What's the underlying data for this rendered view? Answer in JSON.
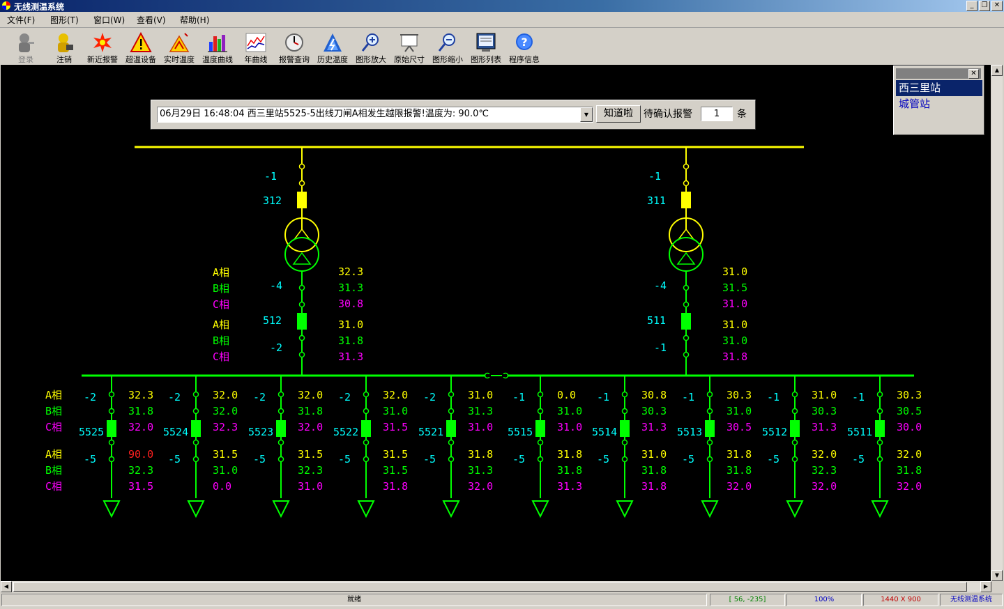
{
  "window": {
    "title": "无线测温系统"
  },
  "menu": [
    {
      "label": "文件(F)"
    },
    {
      "label": "图形(T)"
    },
    {
      "label": "窗口(W)"
    },
    {
      "label": "查看(V)"
    },
    {
      "label": "帮助(H)"
    }
  ],
  "toolbar": [
    {
      "label": "登录",
      "icon": "login-icon",
      "disabled": true
    },
    {
      "label": "注销",
      "icon": "logout-icon"
    },
    {
      "label": "新近报警",
      "icon": "recent-alarm-icon"
    },
    {
      "label": "超温设备",
      "icon": "overtemp-warning-icon"
    },
    {
      "label": "实时温度",
      "icon": "realtime-temp-icon"
    },
    {
      "label": "温度曲线",
      "icon": "temp-curve-icon"
    },
    {
      "label": "年曲线",
      "icon": "year-curve-icon"
    },
    {
      "label": "报警查询",
      "icon": "alarm-query-icon"
    },
    {
      "label": "历史温度",
      "icon": "history-temp-icon"
    },
    {
      "label": "图形放大",
      "icon": "zoom-in-icon"
    },
    {
      "label": "原始尺寸",
      "icon": "original-size-icon"
    },
    {
      "label": "图形缩小",
      "icon": "zoom-out-icon"
    },
    {
      "label": "图形列表",
      "icon": "graphic-list-icon"
    },
    {
      "label": "程序信息",
      "icon": "info-icon"
    }
  ],
  "alarm": {
    "message": "06月29日 16:48:04 西三里站5525-5出线刀闸A相发生越限报警!温度为: 90.0℃",
    "ack_label": "知道啦",
    "pending_label": "待确认报警",
    "pending_count": "1",
    "pending_unit": "条"
  },
  "stations": {
    "items": [
      "西三里站",
      "城管站"
    ],
    "selected": 0
  },
  "colors": {
    "bus": "#ffff00",
    "feeder": "#00ff00",
    "A": "#ffff00",
    "B": "#00ff00",
    "C": "#ff00ff",
    "alarm": "#ff2020",
    "label": "#00ffff"
  },
  "diagram": {
    "phases": [
      "A相",
      "B相",
      "C相"
    ],
    "transformers": [
      {
        "hv_switch": "-1",
        "hv_breaker": "312",
        "lv_switch1": "-4",
        "lv_breaker": "512",
        "lv_switch2": "-2",
        "upper": [
          "32.3",
          "31.3",
          "30.8"
        ],
        "lower": [
          "31.0",
          "31.8",
          "31.3"
        ]
      },
      {
        "hv_switch": "-1",
        "hv_breaker": "311",
        "lv_switch1": "-4",
        "lv_breaker": "511",
        "lv_switch2": "-1",
        "upper": [
          "31.0",
          "31.5",
          "31.0"
        ],
        "lower": [
          "31.0",
          "31.0",
          "31.8"
        ]
      }
    ],
    "feeders": [
      {
        "name": "5525",
        "top_switch": "-2",
        "bot_switch": "-5",
        "upper": [
          "32.3",
          "31.8",
          "32.0"
        ],
        "lower": [
          "90.0",
          "32.3",
          "31.5"
        ],
        "alarm_lower_A": true
      },
      {
        "name": "5524",
        "top_switch": "-2",
        "bot_switch": "-5",
        "upper": [
          "32.0",
          "32.0",
          "32.3"
        ],
        "lower": [
          "31.5",
          "31.0",
          "0.0"
        ]
      },
      {
        "name": "5523",
        "top_switch": "-2",
        "bot_switch": "-5",
        "upper": [
          "32.0",
          "31.8",
          "32.0"
        ],
        "lower": [
          "31.5",
          "32.3",
          "31.0"
        ]
      },
      {
        "name": "5522",
        "top_switch": "-2",
        "bot_switch": "-5",
        "upper": [
          "32.0",
          "31.0",
          "31.5"
        ],
        "lower": [
          "31.5",
          "31.5",
          "31.8"
        ]
      },
      {
        "name": "5521",
        "top_switch": "-2",
        "bot_switch": "-5",
        "upper": [
          "31.0",
          "31.3",
          "31.0"
        ],
        "lower": [
          "31.8",
          "31.3",
          "32.0"
        ]
      },
      {
        "name": "5515",
        "top_switch": "-1",
        "bot_switch": "-5",
        "upper": [
          "0.0",
          "31.0",
          "31.0"
        ],
        "lower": [
          "31.8",
          "31.8",
          "31.3"
        ]
      },
      {
        "name": "5514",
        "top_switch": "-1",
        "bot_switch": "-5",
        "upper": [
          "30.8",
          "30.3",
          "31.3"
        ],
        "lower": [
          "31.0",
          "31.8",
          "31.8"
        ]
      },
      {
        "name": "5513",
        "top_switch": "-1",
        "bot_switch": "-5",
        "upper": [
          "30.3",
          "31.0",
          "30.5"
        ],
        "lower": [
          "31.8",
          "31.8",
          "32.0"
        ]
      },
      {
        "name": "5512",
        "top_switch": "-1",
        "bot_switch": "-5",
        "upper": [
          "31.0",
          "30.3",
          "31.3"
        ],
        "lower": [
          "32.0",
          "32.3",
          "32.0"
        ]
      },
      {
        "name": "5511",
        "top_switch": "-1",
        "bot_switch": "-5",
        "upper": [
          "30.3",
          "30.5",
          "30.0"
        ],
        "lower": [
          "32.0",
          "31.8",
          "32.0"
        ]
      }
    ]
  },
  "status": {
    "ready": "就绪",
    "coords": "[ 56, -235]",
    "zoom": "100%",
    "size": "1440 X 900",
    "app": "无线测温系统"
  }
}
